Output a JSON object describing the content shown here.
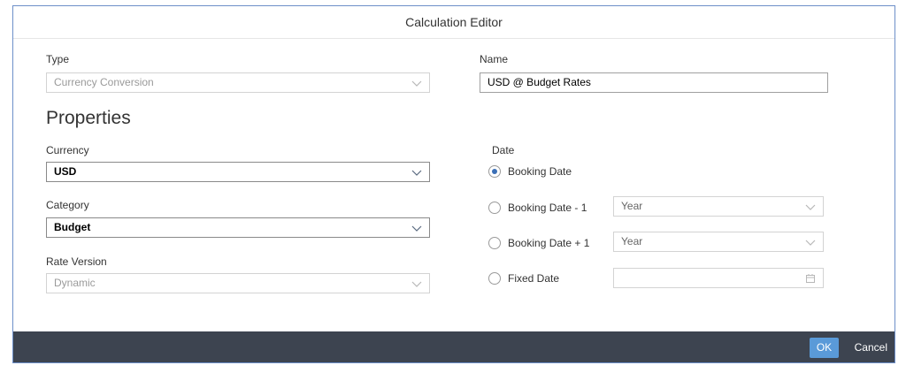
{
  "dialog": {
    "title": "Calculation Editor"
  },
  "type": {
    "label": "Type",
    "value": "Currency Conversion"
  },
  "name": {
    "label": "Name",
    "value": "USD @ Budget Rates"
  },
  "properties": {
    "title": "Properties",
    "currency": {
      "label": "Currency",
      "value": "USD"
    },
    "category": {
      "label": "Category",
      "value": "Budget"
    },
    "rate_version": {
      "label": "Rate Version",
      "value": "Dynamic"
    }
  },
  "date": {
    "label": "Date",
    "options": [
      {
        "label": "Booking Date",
        "checked": true
      },
      {
        "label": "Booking Date - 1",
        "checked": false,
        "select_value": "Year"
      },
      {
        "label": "Booking Date + 1",
        "checked": false,
        "select_value": "Year"
      },
      {
        "label": "Fixed Date",
        "checked": false
      }
    ]
  },
  "footer": {
    "ok_label": "OK",
    "cancel_label": "Cancel"
  },
  "colors": {
    "accent": "#5a9ad8",
    "footer_bg": "#3d4450",
    "border": "#6d8fc9"
  }
}
